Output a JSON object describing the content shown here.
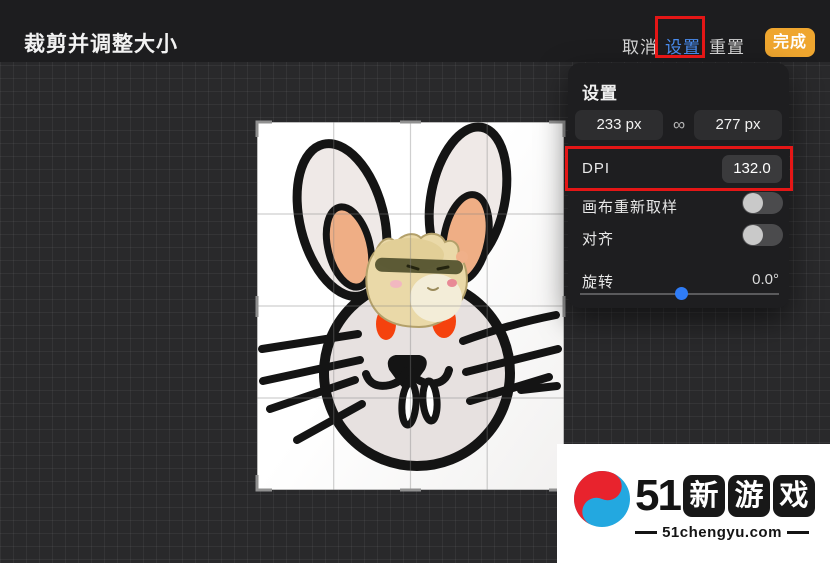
{
  "top_bar": {
    "title": "裁剪并调整大小",
    "cancel": "取消",
    "settings": "设置",
    "reset": "重置",
    "done": "完成"
  },
  "panel": {
    "title": "设置",
    "width_value": "233 px",
    "height_value": "277 px",
    "link_icon": "∞",
    "dpi_label": "DPI",
    "dpi_value": "132.0",
    "resample_label": "画布重新取样",
    "resample_state": "off",
    "align_label": "对齐",
    "align_state": "off",
    "rotation_label": "旋转",
    "rotation_value": "0.0°"
  },
  "watermark": {
    "brand_number": "51",
    "stamps": [
      "新",
      "游",
      "戏"
    ],
    "site": "51chengyu.com"
  },
  "colors": {
    "done_orange": "#efa62f",
    "settings_blue": "#4a8df0",
    "annotation_red": "#e41616",
    "slider_blue": "#2f7cf6",
    "eye_red": "#f5420e",
    "logo_blue": "#23a8e0",
    "logo_red": "#e8232d"
  }
}
